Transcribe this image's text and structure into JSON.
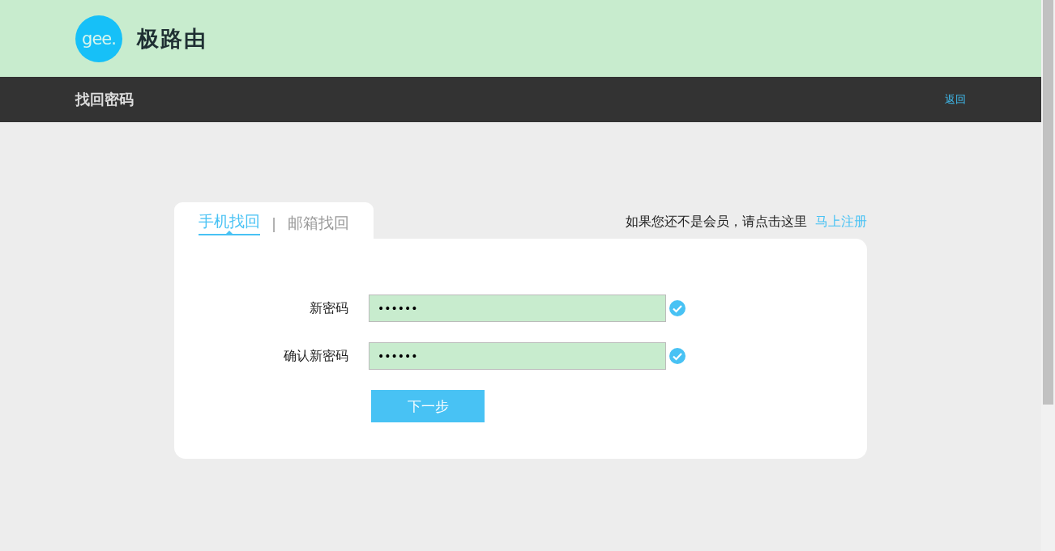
{
  "header": {
    "logo_text": "gee.",
    "brand": "极路由"
  },
  "nav_bar": {
    "title": "找回密码",
    "back_link": "返回"
  },
  "tabs": [
    {
      "label": "手机找回",
      "selected": true
    },
    {
      "label": "邮箱找回",
      "selected": false
    }
  ],
  "tab_separator": "|",
  "register_prompt": {
    "text": "如果您还不是会员，请点击这里",
    "link": "马上注册"
  },
  "fields": [
    {
      "label": "新密码",
      "value": "••••••",
      "valid": true
    },
    {
      "label": "确认新密码",
      "value": "••••••",
      "valid": true
    }
  ],
  "submit_button": "下一步"
}
